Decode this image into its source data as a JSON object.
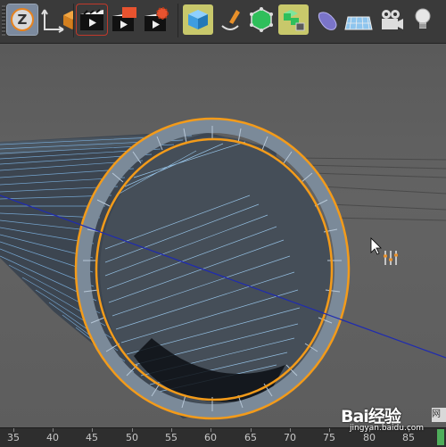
{
  "toolbar": {
    "axis_label": "Z",
    "buttons": [
      "undo-z-icon",
      "coordinate-axis-icon",
      "cube-orange-icon",
      "render-view-icon",
      "render-picture-viewer-icon",
      "render-settings-icon",
      "cube-primitive-icon",
      "pen-spline-icon",
      "subdivision-surface-icon",
      "array-cloner-icon",
      "deformer-icon",
      "floor-plane-icon",
      "camera-icon",
      "light-bulb-icon"
    ]
  },
  "viewport": {
    "selection_color": "#f39b1a",
    "wire_color": "#7fb6e6",
    "axis_color": "#1f2bb0"
  },
  "timeline": {
    "ticks": [
      "35",
      "40",
      "45",
      "50",
      "55",
      "60",
      "65",
      "70",
      "75",
      "80",
      "85"
    ],
    "playhead_color": "#4fae5b"
  },
  "watermark": {
    "brand": "Baiàº¦ç»éª",
    "site": "jingyan.baidu.com",
    "edge_label": "网"
  }
}
